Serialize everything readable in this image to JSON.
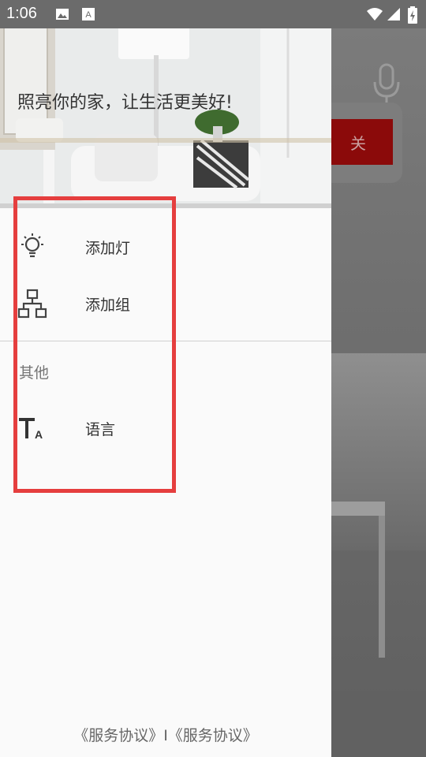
{
  "status_bar": {
    "time": "1:06"
  },
  "header": {
    "title": "照亮你的家，让生活更美好!"
  },
  "menu": {
    "items": [
      {
        "label": "添加灯",
        "icon": "bulb-icon"
      },
      {
        "label": "添加组",
        "icon": "hierarchy-icon"
      }
    ],
    "section_title": "其他",
    "other_items": [
      {
        "label": "语言",
        "icon": "text-size-icon"
      }
    ]
  },
  "footer": {
    "text": "《服务协议》I《服务协议》"
  },
  "background": {
    "switch_label": "关"
  },
  "colors": {
    "accent_red": "#8b0a0a",
    "highlight_border": "#e53e3e"
  }
}
